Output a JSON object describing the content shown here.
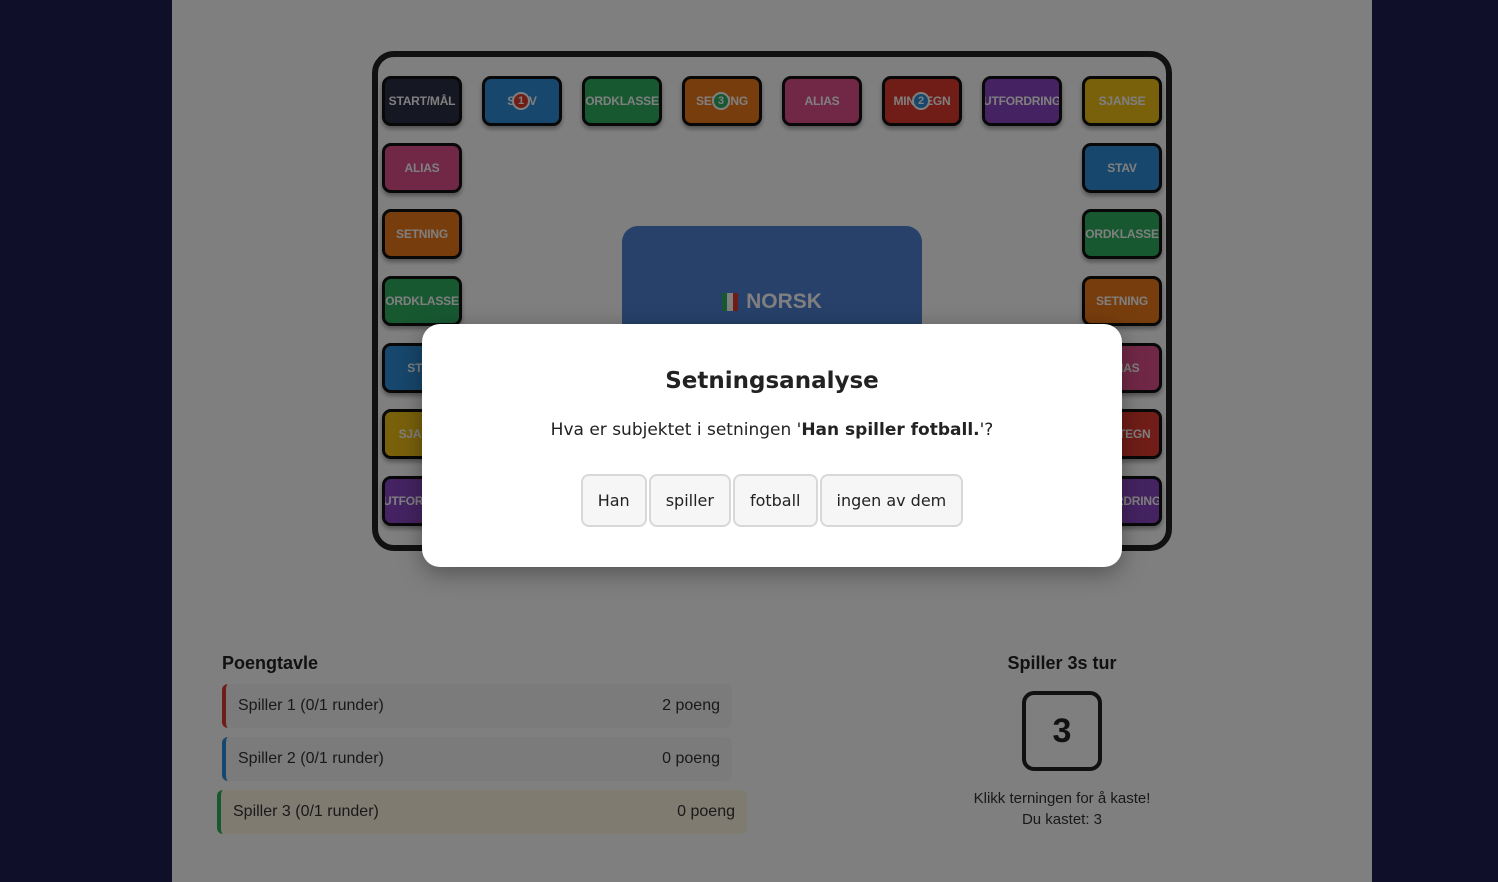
{
  "board": {
    "tiles": [
      {
        "label": "START/MÅL",
        "color": "start"
      },
      {
        "label": "STAV",
        "color": "stav"
      },
      {
        "label": "ORDKLASSE",
        "color": "ordklasse"
      },
      {
        "label": "SETNING",
        "color": "setning"
      },
      {
        "label": "ALIAS",
        "color": "alias"
      },
      {
        "label": "MINITEGN",
        "color": "mintegn"
      },
      {
        "label": "UTFORDRING",
        "color": "utfordring"
      },
      {
        "label": "SJANSE",
        "color": "sjanse"
      },
      {
        "label": "STAV",
        "color": "stav"
      },
      {
        "label": "ORDKLASSE",
        "color": "ordklasse"
      },
      {
        "label": "SETNING",
        "color": "setning"
      },
      {
        "label": "ALIAS",
        "color": "alias"
      },
      {
        "label": "MINITEGN",
        "color": "mintegn"
      },
      {
        "label": "UTFORDRING",
        "color": "utfordring"
      },
      {
        "label": "ALIAS",
        "color": "alias"
      },
      {
        "label": "SETNING",
        "color": "setning"
      },
      {
        "label": "ORDKLASSE",
        "color": "ordklasse"
      },
      {
        "label": "STAV",
        "color": "stav"
      },
      {
        "label": "SJANSE",
        "color": "sjanse"
      },
      {
        "label": "UTFORDRING",
        "color": "utfordring"
      }
    ],
    "tokens": [
      {
        "label": "1",
        "color": "#e03a2f"
      },
      {
        "label": "3",
        "color": "#2fb163"
      },
      {
        "label": "2",
        "color": "#2f8fd8"
      }
    ],
    "center_title": "NORSK",
    "flag_colors": [
      "#2fb163",
      "#ffffff",
      "#e03a2f"
    ]
  },
  "scoreboard": {
    "title": "Poengtavle",
    "rows": [
      {
        "name": "Spiller 1 (0/1 runder)",
        "score": "2 poeng",
        "color": "#e03a2f",
        "active": false
      },
      {
        "name": "Spiller 2 (0/1 runder)",
        "score": "0 poeng",
        "color": "#2f8fd8",
        "active": false
      },
      {
        "name": "Spiller 3 (0/1 runder)",
        "score": "0 poeng",
        "color": "#2fb163",
        "active": true
      }
    ]
  },
  "turn": {
    "title": "Spiller 3s tur",
    "die_value": "3",
    "hint": "Klikk terningen for å kaste!",
    "last_roll": "Du kastet: 3"
  },
  "modal": {
    "title": "Setningsanalyse",
    "question_prefix": "Hva er subjektet i setningen '",
    "question_sentence": "Han spiller fotball.",
    "question_suffix": "'?",
    "options": [
      "Han",
      "spiller",
      "fotball",
      "ingen av dem"
    ]
  }
}
